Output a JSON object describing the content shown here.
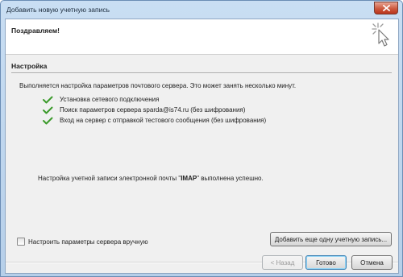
{
  "window": {
    "title": "Добавить новую учетную запись"
  },
  "header": {
    "title": "Поздравляем!"
  },
  "section": {
    "label": "Настройка"
  },
  "intro": "Выполняется настройка параметров почтового сервера. Это может занять несколько минут.",
  "steps": [
    {
      "label": "Установка сетевого подключения",
      "status": "done"
    },
    {
      "label": "Поиск параметров сервера sparda@is74.ru (без шифрования)",
      "status": "done"
    },
    {
      "label": "Вход на сервер с отправкой тестового сообщения (без шифрования)",
      "status": "done"
    }
  ],
  "result": {
    "prefix": "Настройка учетной записи электронной почты \"",
    "protocol": "IMAP",
    "suffix": "\" выполнена успешно."
  },
  "manual_config": {
    "label": "Настроить параметры сервера вручную",
    "checked": false
  },
  "buttons": {
    "add_another": "Добавить еще одну учетную запись...",
    "back": "< Назад",
    "done": "Готово",
    "cancel": "Отмена"
  },
  "colors": {
    "check": "#3a9a2a",
    "accent": "#3c7fb1"
  }
}
